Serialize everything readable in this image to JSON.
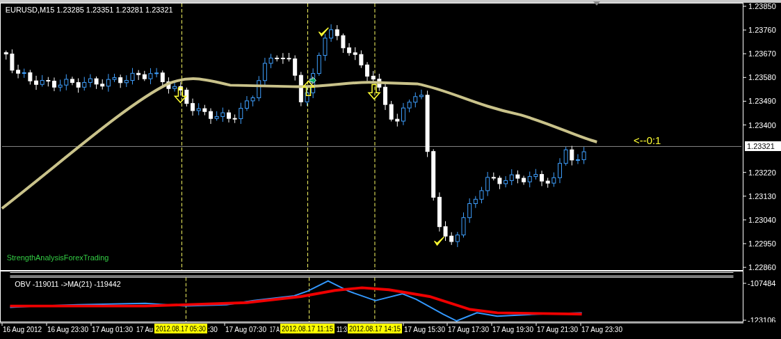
{
  "chart": {
    "symbol_info": "EURUSD,M15  1.23285 1.23351 1.23281 1.23321",
    "caption": "StrengthAnalysisForexTrading",
    "signal_label": "<--0:1",
    "price_ticks": [
      {
        "text": "1.23850",
        "kind": "tick"
      },
      {
        "text": "1.23760",
        "kind": "tick"
      },
      {
        "text": "1.23670",
        "kind": "tick"
      },
      {
        "text": "1.23580",
        "kind": "tick"
      },
      {
        "text": "1.23490",
        "kind": "tick"
      },
      {
        "text": "1.23400",
        "kind": "tick"
      },
      {
        "text": "1.23321",
        "kind": "current"
      },
      {
        "text": "1.23220",
        "kind": "tick"
      },
      {
        "text": "1.23130",
        "kind": "tick"
      },
      {
        "text": "1.23040",
        "kind": "tick"
      },
      {
        "text": "1.22950",
        "kind": "tick"
      },
      {
        "text": "1.22860",
        "kind": "tick"
      }
    ]
  },
  "indicator": {
    "caption": "OBV -119011  ->MA(21) -119442",
    "ticks": [
      "-107484",
      "-123106"
    ]
  },
  "time_axis": {
    "labels": [
      {
        "text": "16 Aug 2012",
        "kind": "plain"
      },
      {
        "text": "16 Aug 23:30",
        "kind": "plain"
      },
      {
        "text": "17 Aug 01:30",
        "kind": "plain"
      },
      {
        "text": "17 Au",
        "kind": "plain"
      },
      {
        "text": "2012.08.17 05:30",
        "kind": "marker"
      },
      {
        "text": ":30",
        "kind": "plain"
      },
      {
        "text": "17 Aug 07:30",
        "kind": "plain"
      },
      {
        "text": "17 A",
        "kind": "plain"
      },
      {
        "text": "2012.08.17 11:15",
        "kind": "marker"
      },
      {
        "text": "11:3",
        "kind": "plain"
      },
      {
        "text": "2012.08.17 14:15",
        "kind": "marker"
      },
      {
        "text": "17 Aug 15:30",
        "kind": "plain"
      },
      {
        "text": "17 Aug 17:30",
        "kind": "plain"
      },
      {
        "text": "17 Aug 19:30",
        "kind": "plain"
      },
      {
        "text": "17 Aug 21:30",
        "kind": "plain"
      },
      {
        "text": "17 Aug 23:30",
        "kind": "plain"
      }
    ]
  }
}
